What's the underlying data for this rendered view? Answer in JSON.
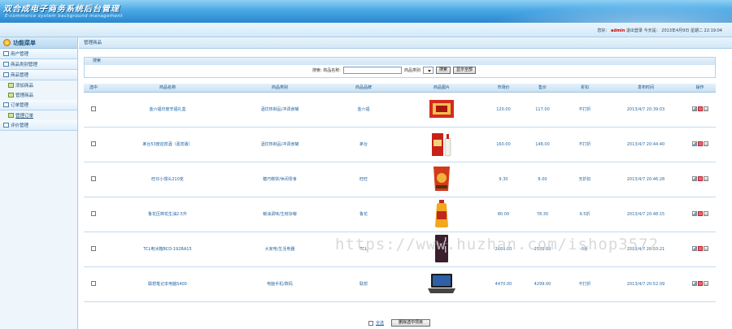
{
  "header": {
    "title": "双合成电子商务系统后台管理",
    "subtitle": "E-commerce system background management",
    "greeting": "您好：",
    "username": "admin",
    "logout": "退出登录",
    "today_label": "今天是：",
    "date": "2013年4月9日 星期二 22:19:04"
  },
  "sidebar": {
    "heading": "功能菜单",
    "items": [
      {
        "label": "用户管理",
        "type": "group"
      },
      {
        "label": "商品类别管理",
        "type": "group"
      },
      {
        "label": "商品管理",
        "type": "group"
      },
      {
        "label": "添加商品",
        "type": "sub"
      },
      {
        "label": "管理商品",
        "type": "sub"
      },
      {
        "label": "订单管理",
        "type": "group"
      },
      {
        "label": "管理订单",
        "type": "sub"
      },
      {
        "label": "评价管理",
        "type": "group"
      }
    ]
  },
  "breadcrumb": "管理商品",
  "search": {
    "panel_title": "搜索",
    "name_label": "搜索: 商品名称:",
    "name_value": "",
    "category_label": "商品类别",
    "search_button": "搜索",
    "show_all_button": "显示全部"
  },
  "table": {
    "headers": [
      "选中",
      "商品名称",
      "商品类别",
      "商品品牌",
      "商品图片",
      "市场价",
      "售价",
      "折扣",
      "发布时间",
      "操作"
    ],
    "rows": [
      {
        "name": "金六福印度辛福礼盒",
        "category": "酒饮热制品/冲调食罐",
        "brand": "金六福",
        "market": "120.00",
        "price": "117.00",
        "discount": "不打折",
        "time": "2013/4/7 20:39:03",
        "img": "giftbox"
      },
      {
        "name": "茅台53度迎宾酒（嘉宾版）",
        "category": "酒饮热制品/冲调食罐",
        "brand": "茅台",
        "market": "160.00",
        "price": "148.00",
        "discount": "不打折",
        "time": "2013/4/7 20:44:40",
        "img": "liquor"
      },
      {
        "name": "旺仔小馒头210克",
        "category": "糖巧糕饼/休闲零食",
        "brand": "旺旺",
        "market": "9.30",
        "price": "8.00",
        "discount": "无折扣",
        "time": "2013/4/7 20:46:28",
        "img": "snack"
      },
      {
        "name": "鲁花压榨花生油2.5升",
        "category": "粮油调味/生鲜杂粮",
        "brand": "鲁花",
        "market": "80.00",
        "price": "78.30",
        "discount": "9.5折",
        "time": "2013/4/7 20:48:15",
        "img": "oil"
      },
      {
        "name": "TCL电冰箱BCD-192BA15",
        "category": "大家电/生活电器",
        "brand": "TCL",
        "market": "2699.00",
        "price": "2599.00",
        "discount": "9折",
        "time": "2013/4/7 20:50:21",
        "img": "fridge"
      },
      {
        "name": "联想笔记本电脑S400",
        "category": "电脑手机/数码",
        "brand": "联想",
        "market": "4470.00",
        "price": "4299.00",
        "discount": "不打折",
        "time": "2013/4/7 20:52.09",
        "img": "laptop"
      }
    ]
  },
  "footer": {
    "select_all": "全选",
    "delete_selected": "删除选中项目"
  },
  "watermark": "https://www.huzhan.com/ishop3572",
  "colors": {
    "banner": "#2a87cf",
    "link": "#1c64a8",
    "username": "#d40000"
  }
}
